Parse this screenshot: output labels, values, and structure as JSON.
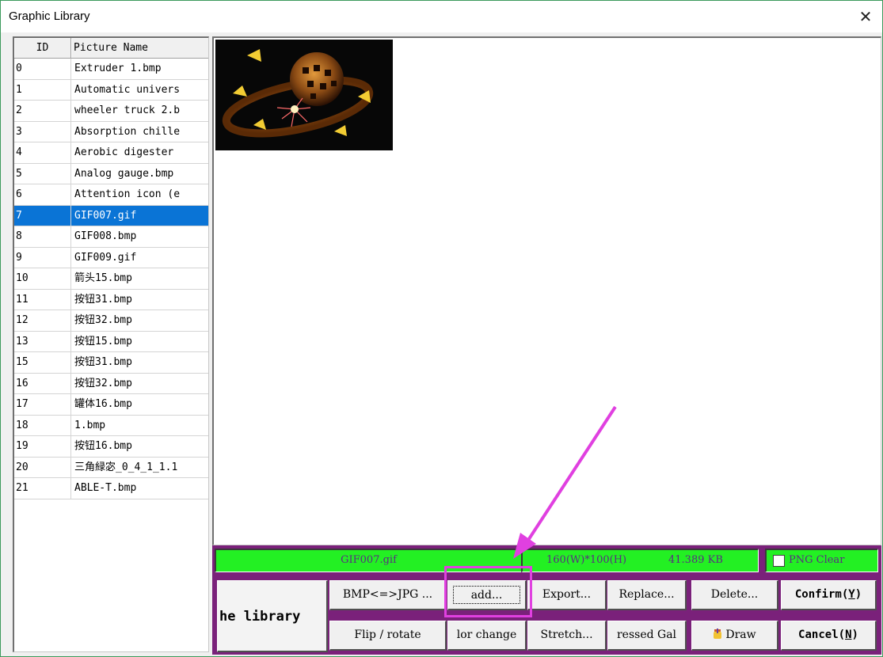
{
  "window": {
    "title": "Graphic Library",
    "close_glyph": "✕"
  },
  "list": {
    "headers": {
      "id": "ID",
      "name": "Picture Name"
    },
    "rows": [
      {
        "id": "0",
        "name": "Extruder 1.bmp"
      },
      {
        "id": "1",
        "name": "Automatic univers"
      },
      {
        "id": "2",
        "name": "wheeler truck 2.b"
      },
      {
        "id": "3",
        "name": "Absorption chille"
      },
      {
        "id": "4",
        "name": "Aerobic digester"
      },
      {
        "id": "5",
        "name": "Analog gauge.bmp"
      },
      {
        "id": "6",
        "name": "Attention icon (e"
      },
      {
        "id": "7",
        "name": "GIF007.gif"
      },
      {
        "id": "8",
        "name": "GIF008.bmp"
      },
      {
        "id": "9",
        "name": "GIF009.gif"
      },
      {
        "id": "10",
        "name": "箭头15.bmp"
      },
      {
        "id": "11",
        "name": "按钮31.bmp"
      },
      {
        "id": "12",
        "name": "按钮32.bmp"
      },
      {
        "id": "13",
        "name": "按钮15.bmp"
      },
      {
        "id": "15",
        "name": "按钮31.bmp"
      },
      {
        "id": "16",
        "name": "按钮32.bmp"
      },
      {
        "id": "17",
        "name": "罐体16.bmp"
      },
      {
        "id": "18",
        "name": "1.bmp"
      },
      {
        "id": "19",
        "name": "按钮16.bmp"
      },
      {
        "id": "20",
        "name": "三角緑宓_0_4_1_1.1"
      },
      {
        "id": "21",
        "name": "ABLE-T.bmp"
      }
    ],
    "selected_id": "7"
  },
  "preview": {
    "image_icon": "gear-sphere-thumbnail"
  },
  "status": {
    "filename": "GIF007.gif",
    "dimensions": "160(W)*100(H)",
    "filesize": "41.389 KB",
    "png_clear_label": "PNG Clear",
    "png_clear_checked": false
  },
  "buttons": {
    "library": "he library",
    "bmp_jpg": "BMP<=>JPG ...",
    "add": "add...",
    "export": "Export...",
    "replace": "Replace...",
    "delete": "Delete...",
    "confirm_prefix": "Confirm(",
    "confirm_key": "Y",
    "confirm_suffix": ")",
    "flip": "Flip / rotate",
    "color": "lor change",
    "stretch": "Stretch...",
    "compressed": "ressed Gal",
    "draw": "Draw",
    "cancel_prefix": "Cancel(",
    "cancel_key": "N",
    "cancel_suffix": ")"
  },
  "colors": {
    "status_green": "#23f023",
    "panel_purple": "#7a217a",
    "selection_blue": "#0a74d6",
    "annotation_magenta": "#e040e0"
  }
}
